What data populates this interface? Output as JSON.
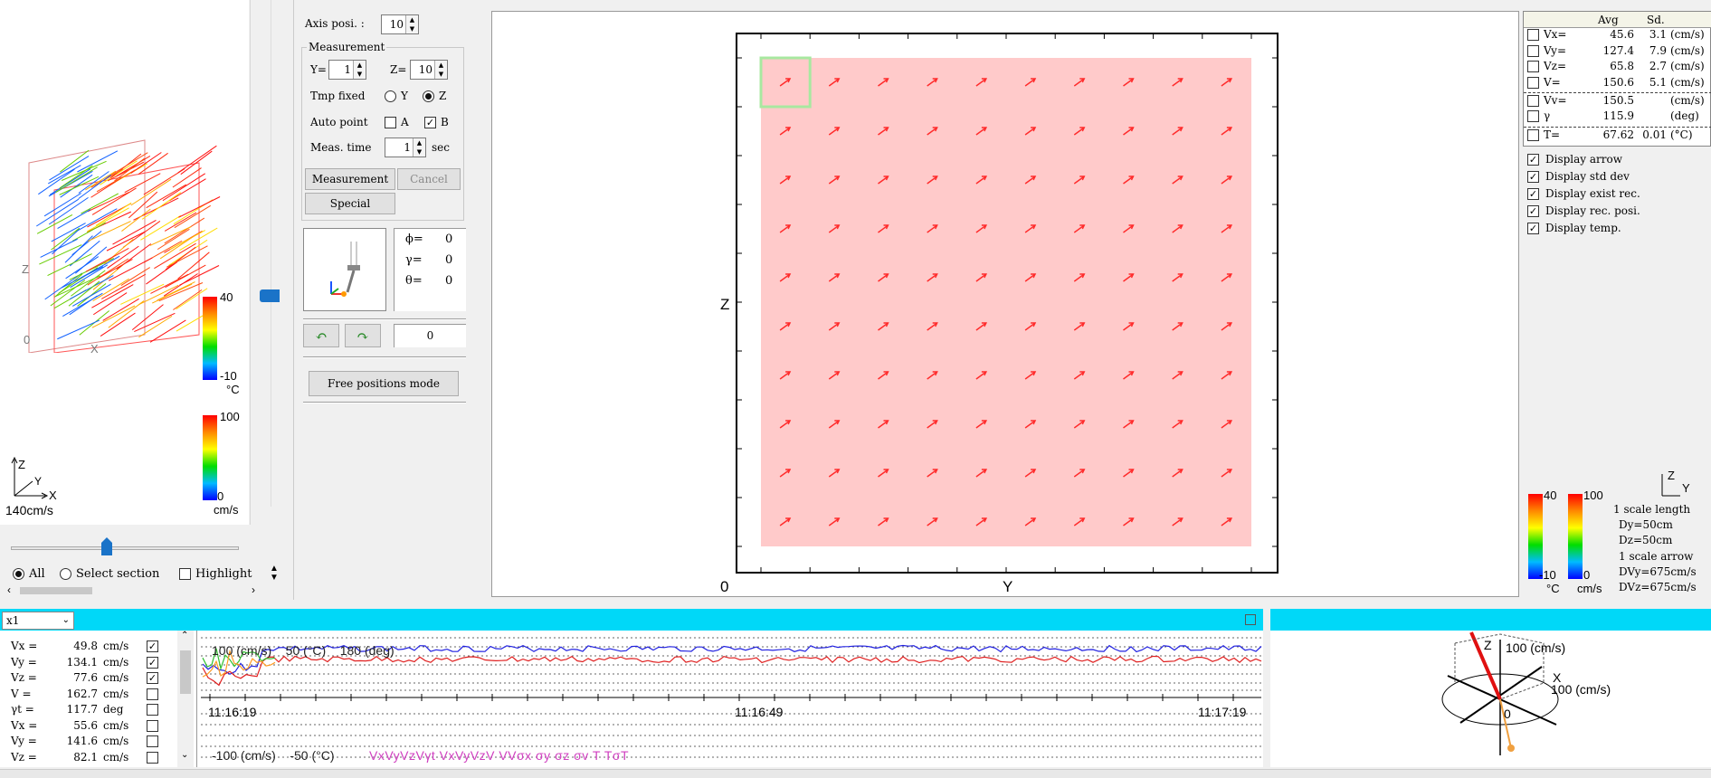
{
  "left_panel": {
    "scale_label": "140cm/s",
    "temp_scale_max": "40",
    "temp_scale_min": "-10",
    "temp_unit": "°C",
    "speed_scale_max": "100",
    "speed_scale_min": "0",
    "speed_unit": "cm/s",
    "axis_z": "Z",
    "axis_x": "X",
    "axis_y": "Y",
    "origin": "0",
    "radio_all": "All",
    "radio_select": "Select section",
    "highlight": "Highlight"
  },
  "controls": {
    "axis_posi_label": "Axis posi. :",
    "axis_posi_value": "10",
    "measurement_group": "Measurement",
    "y_label": "Y=",
    "y_value": "1",
    "z_label": "Z=",
    "z_value": "10",
    "tmp_fixed_label": "Tmp fixed",
    "tmp_fixed_y": "Y",
    "tmp_fixed_z": "Z",
    "auto_point_label": "Auto point",
    "auto_point_a": "A",
    "auto_point_b": "B",
    "meas_time_label": "Meas. time",
    "meas_time_value": "1",
    "meas_time_unit": "sec",
    "measurement_button": "Measurement",
    "cancel_button": "Cancel",
    "special_button": "Special",
    "phi_label": "ϕ=",
    "phi_value": "0",
    "gamma_label": "γ=",
    "gamma_value": "0",
    "theta_label": "θ=",
    "theta_value": "0",
    "rotation_value": "0",
    "free_positions_button": "Free positions mode"
  },
  "plot": {
    "z_label": "Z",
    "y_label": "Y",
    "origin": "0",
    "rows": 10,
    "cols": 10,
    "arrow_color": "#ff2a2a",
    "field_color": "#ffcaca",
    "selected_cell": [
      0,
      0
    ]
  },
  "stats": {
    "col_avg": "Avg",
    "col_sd": "Sd.",
    "rows": [
      {
        "label": "Vx=",
        "avg": "45.6",
        "sd": "3.1",
        "unit": "(cm/s)"
      },
      {
        "label": "Vy=",
        "avg": "127.4",
        "sd": "7.9",
        "unit": "(cm/s)"
      },
      {
        "label": "Vz=",
        "avg": "65.8",
        "sd": "2.7",
        "unit": "(cm/s)"
      },
      {
        "label": "V=",
        "avg": "150.6",
        "sd": "5.1",
        "unit": "(cm/s)"
      },
      {
        "label": "Vv=",
        "avg": "150.5",
        "sd": "",
        "unit": "(cm/s)"
      },
      {
        "label": "γ",
        "avg": "115.9",
        "sd": "",
        "unit": "(deg)"
      },
      {
        "label": "T=",
        "avg": "67.62",
        "sd": "0.01",
        "unit": "(°C)"
      }
    ],
    "options": [
      {
        "label": "Display arrow",
        "checked": true
      },
      {
        "label": "Display std dev",
        "checked": true
      },
      {
        "label": "Display exist rec.",
        "checked": true
      },
      {
        "label": "Display rec. posi.",
        "checked": true
      },
      {
        "label": "Display temp.",
        "checked": true
      }
    ]
  },
  "legend": {
    "temp_max": "40",
    "temp_min": "-10",
    "temp_unit": "°C",
    "speed_max": "100",
    "speed_min": "0",
    "speed_unit": "cm/s",
    "axis_z": "Z",
    "axis_y": "Y",
    "scale_length": "1 scale length",
    "dy": "Dy=50cm",
    "dz": "Dz=50cm",
    "scale_arrow": "1 scale arrow",
    "dvy": "DVy=675cm/s",
    "dvz": "DVz=675cm/s"
  },
  "timeseries": {
    "multiplier": "x1",
    "values": [
      {
        "label": "Vx =",
        "value": "49.8",
        "unit": "cm/s",
        "checked": true
      },
      {
        "label": "Vy =",
        "value": "134.1",
        "unit": "cm/s",
        "checked": true
      },
      {
        "label": "Vz =",
        "value": "77.6",
        "unit": "cm/s",
        "checked": true
      },
      {
        "label": "V =",
        "value": "162.7",
        "unit": "cm/s",
        "checked": false
      },
      {
        "label": "γt =",
        "value": "117.7",
        "unit": "deg",
        "checked": false
      },
      {
        "label": "Vx =",
        "value": "55.6",
        "unit": "cm/s",
        "checked": false
      },
      {
        "label": "Vy =",
        "value": "141.6",
        "unit": "cm/s",
        "checked": false
      },
      {
        "label": "Vz =",
        "value": "82.1",
        "unit": "cm/s",
        "checked": false
      }
    ],
    "top_scale": "100 (cm/s)    50 (°C)    180 (deg)",
    "bottom_scale": "-100 (cm/s)    -50 (°C)",
    "times": [
      "11:16:19",
      "11:16:49",
      "11:17:19"
    ],
    "legend_text": "VxVyVzVγt VxVyVzV VVσx σy σz σv T TσT"
  },
  "vector3d": {
    "z_label": "Z",
    "z_value": "100 (cm/s)",
    "x_label": "X",
    "x_value": "100 (cm/s)",
    "origin": "0"
  }
}
